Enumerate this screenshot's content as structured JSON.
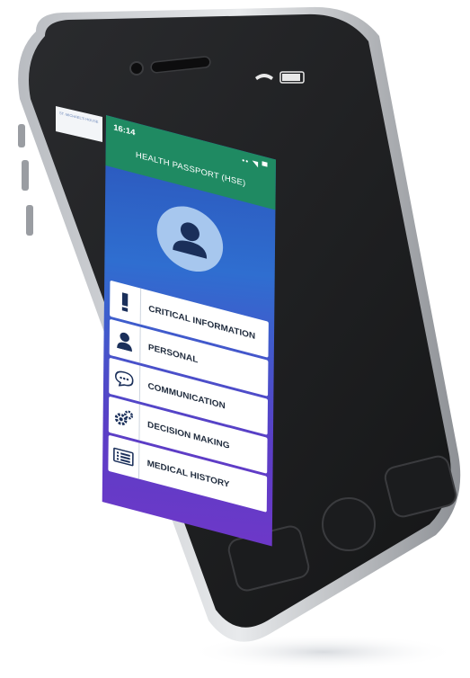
{
  "status_bar": {
    "time": "16:14",
    "icons": "•• ◥ ▀"
  },
  "app": {
    "title": "HEALTH PASSPORT (HSE)"
  },
  "menu": [
    {
      "label": "CRITICAL INFORMATION",
      "icon": "exclamation-icon"
    },
    {
      "label": "PERSONAL",
      "icon": "person-icon"
    },
    {
      "label": "COMMUNICATION",
      "icon": "speech-bubble-icon"
    },
    {
      "label": "DECISION MAKING",
      "icon": "gears-icon"
    },
    {
      "label": "MEDICAL HISTORY",
      "icon": "document-list-icon"
    }
  ],
  "corner_tab": {
    "text": "ST. MICHAEL'S HOUSE"
  },
  "colors": {
    "header": "#1f8a62",
    "screen_top": "#2b52b8",
    "screen_bottom": "#6d38c8",
    "avatar_bg": "#a7c7ee",
    "menu_text": "#1e2a3c"
  }
}
